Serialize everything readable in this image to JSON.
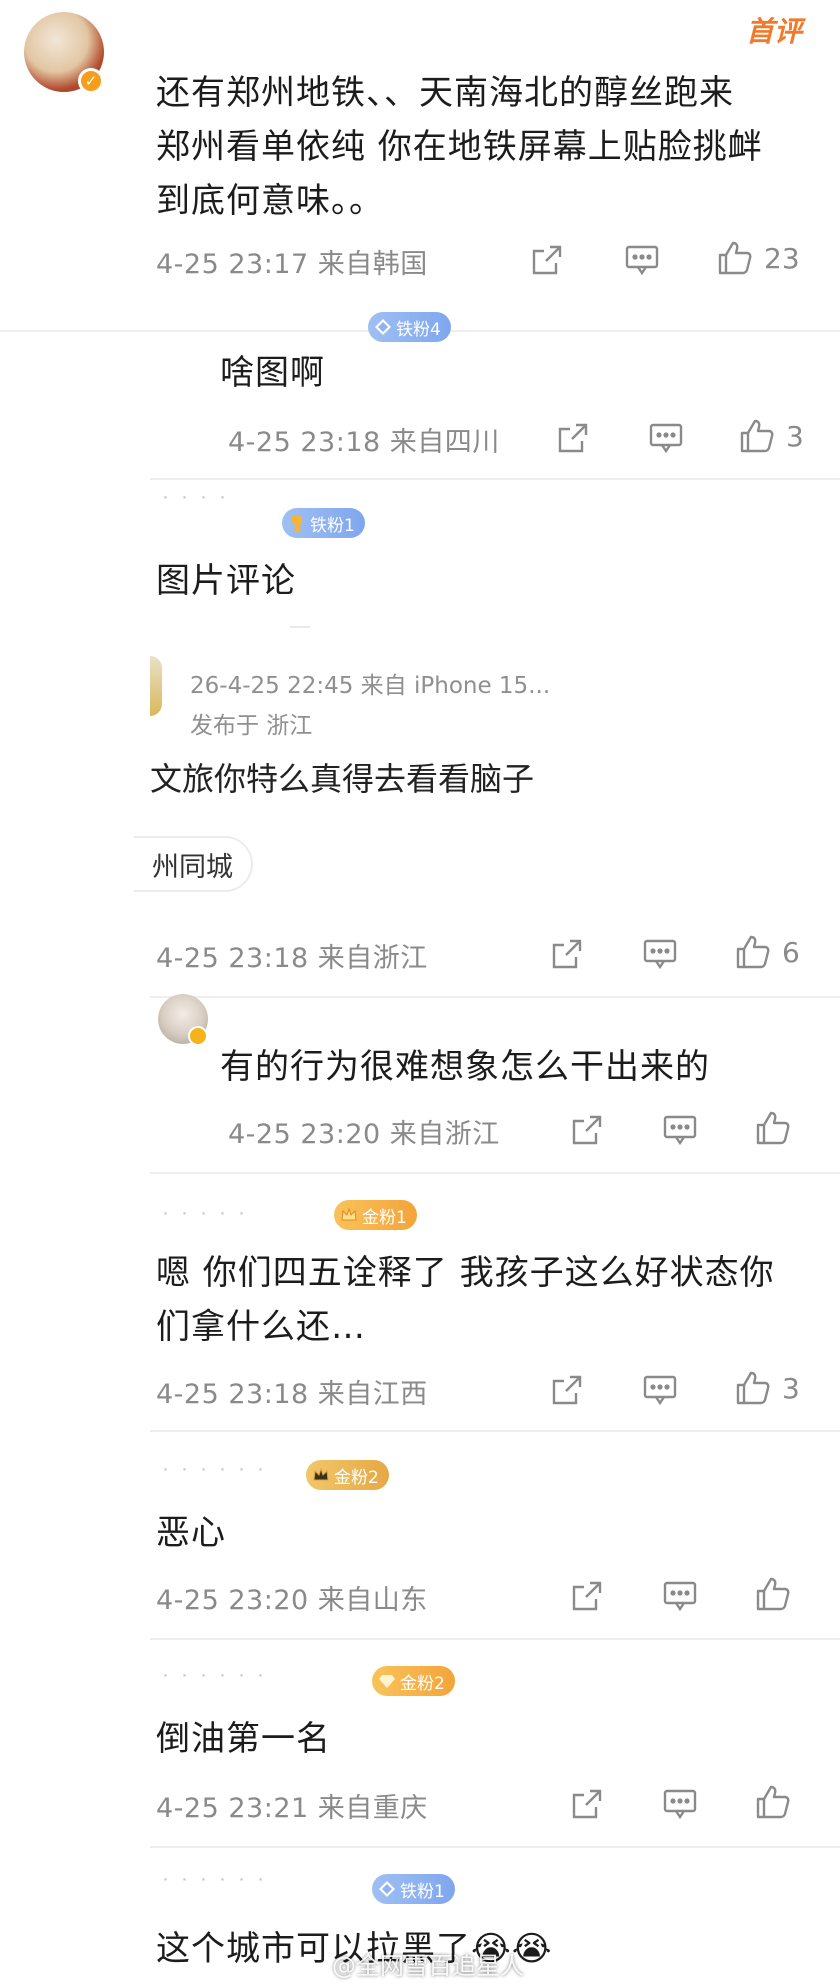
{
  "hot_label": "首评",
  "watermark": "@全网雪百追星人",
  "comments": [
    {
      "text_lines": [
        "还有郑州地铁、、天南海北的醇丝跑来",
        "郑州看单依纯 你在地铁屏幕上贴脸挑衅",
        "到底何意味。。"
      ],
      "time": "4-25 23:17 来自韩国",
      "likes": "23"
    },
    {
      "badge": "铁粉4",
      "text_lines": [
        "啥图啊"
      ],
      "time": "4-25 23:18 来自四川",
      "likes": "3"
    },
    {
      "badge": "铁粉1",
      "text_lines": [
        "图片评论"
      ],
      "quoted": {
        "time": "26-4-25 22:45 来自 iPhone 15...",
        "location": "发布于 浙江",
        "text": "文旅你特么真得去看看脑子",
        "tag": "州同城"
      },
      "time": "4-25 23:18 来自浙江",
      "likes": "6"
    },
    {
      "text_lines": [
        "有的行为很难想象怎么干出来的"
      ],
      "time": "4-25 23:20 来自浙江",
      "likes": ""
    },
    {
      "badge": "金粉1",
      "badge_level": "1",
      "text_lines": [
        "嗯 你们四五诠释了 我孩子这么好状态你",
        "们拿什么还…"
      ],
      "time": "4-25 23:18 来自江西",
      "likes": "3"
    },
    {
      "badge": "金粉2",
      "text_lines": [
        "恶心"
      ],
      "time": "4-25 23:20 来自山东",
      "likes": ""
    },
    {
      "badge": "金粉2",
      "text_lines": [
        "倒油第一名"
      ],
      "time": "4-25 23:21 来自重庆",
      "likes": ""
    },
    {
      "badge": "铁粉1",
      "text_lines": [
        "这个城市可以拉黑了"
      ],
      "emoji": "😭😭"
    }
  ],
  "colors": {
    "accent_orange": "#f07a2a",
    "badge_blue": "#8fb2f2",
    "badge_gold": "#f4a83e",
    "meta_gray": "#8a8a8a"
  }
}
